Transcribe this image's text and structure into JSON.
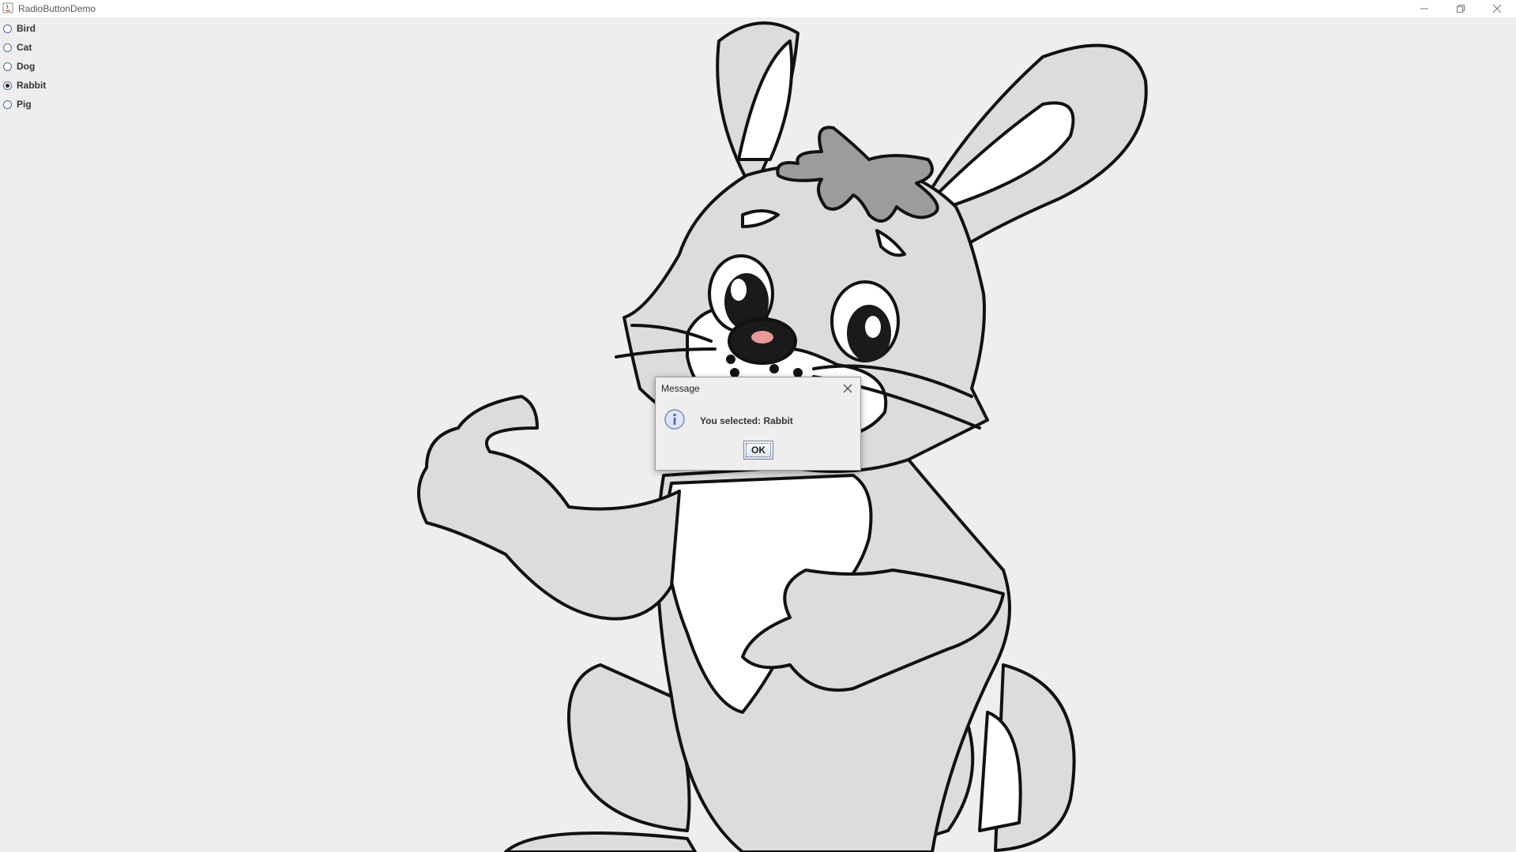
{
  "window": {
    "title": "RadioButtonDemo"
  },
  "radio_options": [
    {
      "label": "Bird",
      "selected": false
    },
    {
      "label": "Cat",
      "selected": false
    },
    {
      "label": "Dog",
      "selected": false
    },
    {
      "label": "Rabbit",
      "selected": true
    },
    {
      "label": "Pig",
      "selected": false
    }
  ],
  "dialog": {
    "title": "Message",
    "message": "You selected: Rabbit",
    "ok_label": "OK",
    "icon": "info-icon"
  },
  "colors": {
    "background": "#eeeeee",
    "rabbit_fill": "#dcdcdc",
    "tuft_fill": "#9c9c9c",
    "nose_fill": "#e79a9a"
  }
}
